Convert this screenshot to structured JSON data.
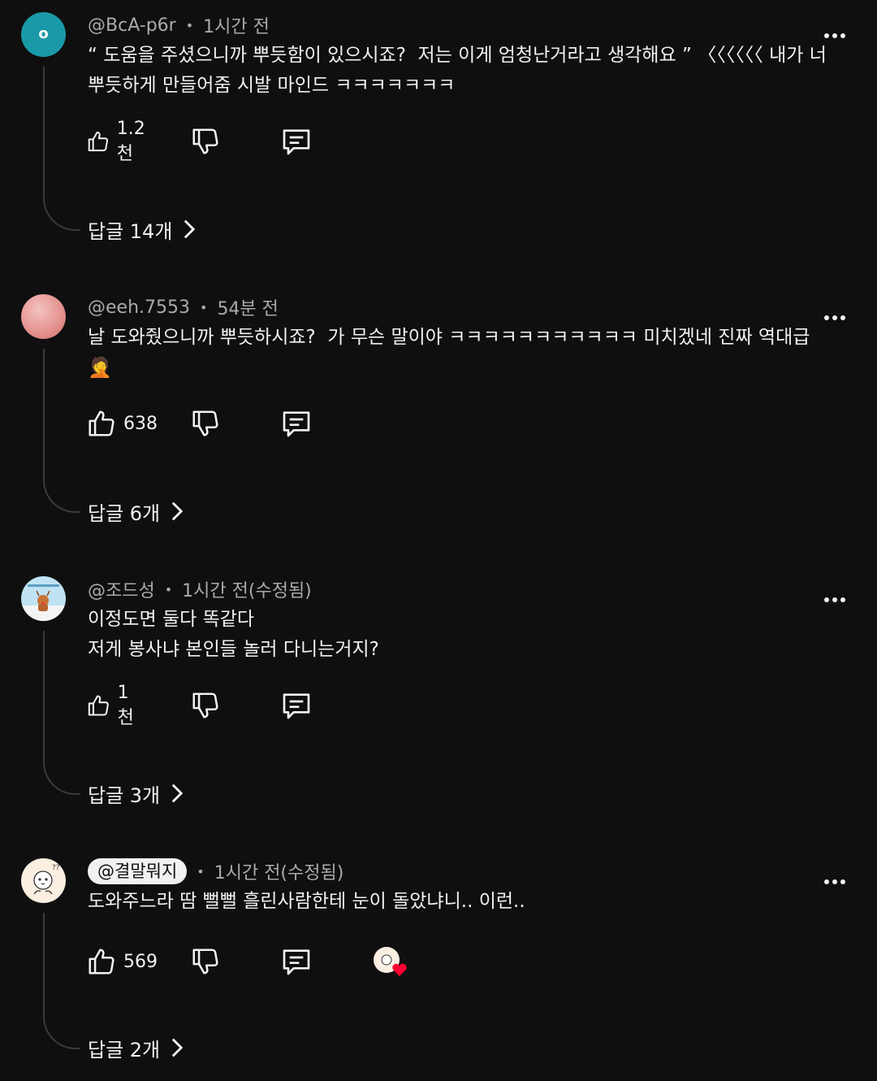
{
  "comments": [
    {
      "handle": "@BcA-p6r",
      "time": "1시간 전",
      "text": "“ 도움을 주셨으니까 뿌듯함이 있으시죠?  저는 이게 엄청난거라고 생각해요 ” 〈〈〈〈〈〈 내가 너 뿌듯하게 만들어줌 시발 마인드 ㅋㅋㅋㅋㅋㅋㅋ",
      "likes": "1.2천",
      "replies": "답글 14개",
      "avatar_letter": "o",
      "avatar_color": "#1a9aa8"
    },
    {
      "handle": "@eeh.7553",
      "time": "54분 전",
      "text": "날 도와줬으니까 뿌듯하시죠?  가 무슨 말이야 ㅋㅋㅋㅋㅋㅋㅋㅋㅋㅋㅋ 미치겠네 진짜 역대급",
      "emoji": "🤦",
      "likes": "638",
      "replies": "답글 6개",
      "avatar_color": "#e89a98"
    },
    {
      "handle": "@조드성",
      "time": "1시간 전(수정됨)",
      "text": "이정도면 둘다 똑같다\n저게 봉사냐 본인들 놀러 다니는거지?",
      "likes": "1천",
      "replies": "답글 3개",
      "avatar_color": "#bfe3f2"
    },
    {
      "handle": "@결말뭐지",
      "time": "1시간 전(수정됨)",
      "text": "도와주느라 땀 뻘뻘 흘린사람한테 눈이 돌았냐니.. 이런..",
      "likes": "569",
      "replies": "답글 2개",
      "avatar_color": "#fbefe1",
      "heart_color": "#ff0033"
    }
  ]
}
